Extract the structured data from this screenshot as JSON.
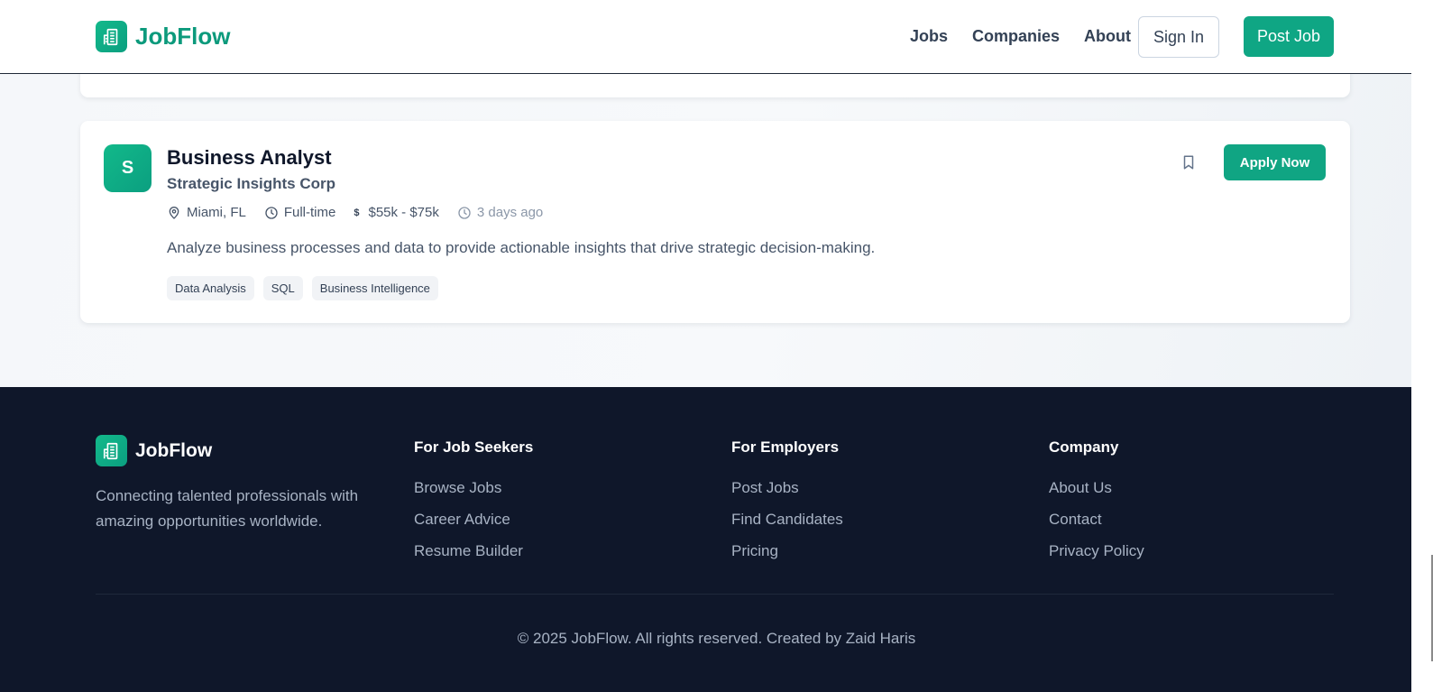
{
  "header": {
    "brand": "JobFlow",
    "nav": [
      "Jobs",
      "Companies",
      "About"
    ],
    "sign_in": "Sign In",
    "post_job": "Post Job"
  },
  "job": {
    "logo_letter": "S",
    "title": "Business Analyst",
    "company": "Strategic Insights Corp",
    "location": "Miami, FL",
    "type": "Full-time",
    "salary_symbol": "$",
    "salary": "$55k - $75k",
    "posted": "3 days ago",
    "description": "Analyze business processes and data to provide actionable insights that drive strategic decision-making.",
    "tags": [
      "Data Analysis",
      "SQL",
      "Business Intelligence"
    ],
    "apply_label": "Apply Now"
  },
  "footer": {
    "brand": "JobFlow",
    "tagline": "Connecting talented professionals with amazing opportunities worldwide.",
    "columns": [
      {
        "title": "For Job Seekers",
        "links": [
          "Browse Jobs",
          "Career Advice",
          "Resume Builder"
        ]
      },
      {
        "title": "For Employers",
        "links": [
          "Post Jobs",
          "Find Candidates",
          "Pricing"
        ]
      },
      {
        "title": "Company",
        "links": [
          "About Us",
          "Contact",
          "Privacy Policy"
        ]
      }
    ],
    "copyright": "© 2025 JobFlow. All rights reserved. Created by Zaid Haris"
  },
  "colors": {
    "brand_green": "#0fa684",
    "footer_bg": "#0f172a",
    "text_dark": "#0f172a",
    "text_muted": "#475569"
  },
  "icons": {
    "logo": "building-icon",
    "location": "map-pin-icon",
    "job_type": "clock-icon",
    "posted": "clock-icon",
    "save": "bookmark-icon"
  }
}
